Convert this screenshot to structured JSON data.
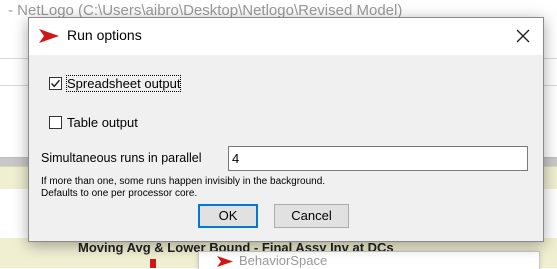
{
  "background": {
    "window_title": "- NetLogo (C:\\Users\\aibro\\Desktop\\Netlogo\\Revised Model)",
    "plot_title": "Moving Avg & Lower Bound - Final Assy Inv at DCs",
    "second_window_title": "BehaviorSpace"
  },
  "dialog": {
    "title": "Run options",
    "close_label": "Close",
    "spreadsheet_output": {
      "label": "Spreadsheet output",
      "checked": true
    },
    "table_output": {
      "label": "Table output",
      "checked": false
    },
    "simultaneous_runs": {
      "label": "Simultaneous runs in parallel",
      "value": "4"
    },
    "note_line1": "If more than one, some runs happen invisibly in the background.",
    "note_line2": "Defaults to one per processor core.",
    "ok_label": "OK",
    "cancel_label": "Cancel"
  },
  "colors": {
    "accent": "#0078d7",
    "logo_red": "#d01818"
  }
}
